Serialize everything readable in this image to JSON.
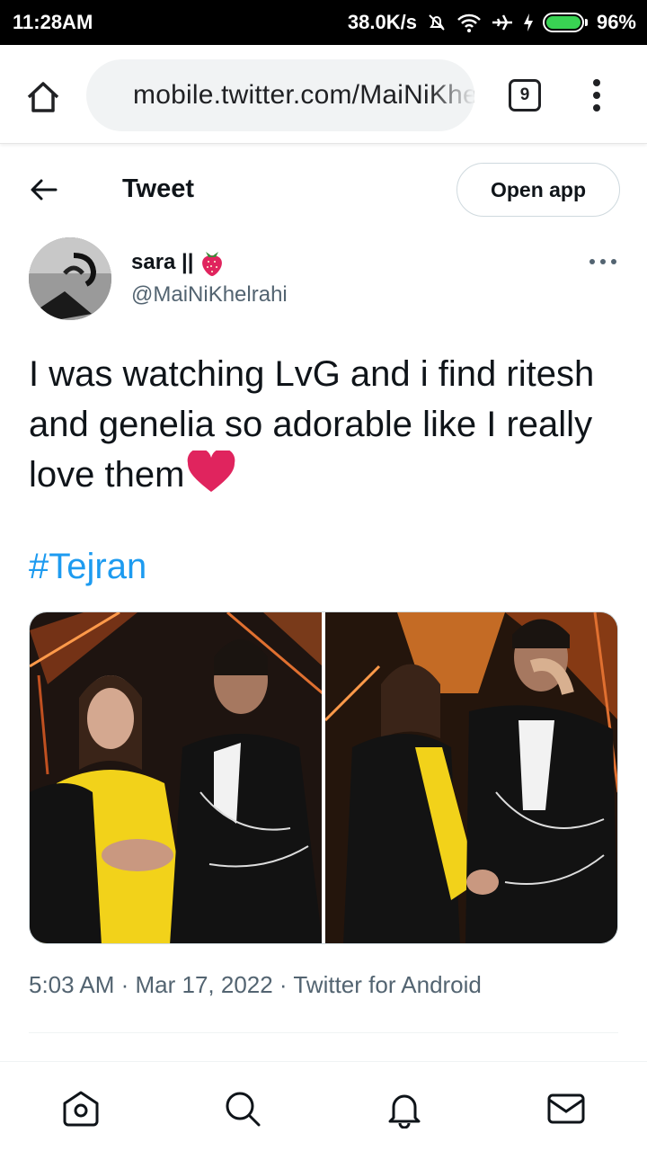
{
  "status_bar": {
    "time": "11:28AM",
    "speed": "38.0K/s",
    "battery": "96%"
  },
  "browser": {
    "url": "mobile.twitter.com/MaiNiKhelrahi/status",
    "tab_count": "9"
  },
  "header": {
    "title": "Tweet",
    "open_app_label": "Open app"
  },
  "tweet": {
    "author_name": "sara ||",
    "author_handle": "@MaiNiKhelrahi",
    "text": "I was watching LvG and i find ritesh and genelia so adorable like I really love them",
    "hashtag": "#Tejran",
    "meta": "5:03 AM · Mar 17, 2022 · Twitter for Android"
  },
  "icons": [
    "home-icon",
    "lock-icon",
    "back-arrow-icon",
    "more-icon",
    "search-icon",
    "bell-icon",
    "mail-icon",
    "heart-emoji",
    "strawberry-emoji"
  ],
  "colors": {
    "link": "#1d9bf0",
    "secondary_text": "#536471",
    "heart": "#e0245e"
  }
}
